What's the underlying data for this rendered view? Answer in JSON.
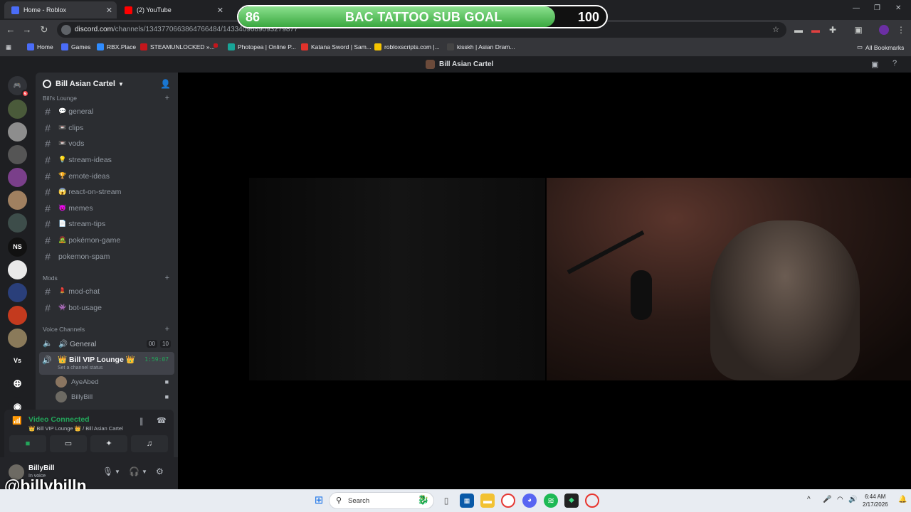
{
  "browser": {
    "tabs": [
      {
        "title": "Home - Roblox",
        "color": "#4a6cf7"
      },
      {
        "title": "(2) YouTube",
        "color": "#ff0000"
      }
    ],
    "url_main": "discord.com",
    "url_rest": "/channels/1343770663864766484/1433409689093279877",
    "bookmarks": [
      {
        "label": "Home",
        "color": "#4a6cf7"
      },
      {
        "label": "Games",
        "color": "#4a6cf7"
      },
      {
        "label": "RBX.Place",
        "color": "#2f8cff"
      },
      {
        "label": "STEAMUNLOCKED »...",
        "color": "#c4161c"
      },
      {
        "label": "Photopea | Online P...",
        "color": "#18a497"
      },
      {
        "label": "Katana Sword | Sam...",
        "color": "#e0322b"
      },
      {
        "label": "robloxscripts.com |...",
        "color": "#f5c400"
      },
      {
        "label": "kisskh | Asian Dram...",
        "color": "#444"
      }
    ],
    "all_bookmarks": "All Bookmarks"
  },
  "goal": {
    "current": "86",
    "label": "BAC TATTOO SUB GOAL",
    "target": "100",
    "progress_fraction": 0.86
  },
  "discord": {
    "window_title": "Bill Asian Cartel",
    "server_name": "Bill Asian Cartel",
    "home_badge": "5",
    "server_labels": [
      "NS",
      "Vs"
    ],
    "categories": {
      "lounge": "Bill's Lounge",
      "mods": "Mods",
      "voice": "Voice Channels"
    },
    "text_channels": [
      {
        "name": "general",
        "emoji": "💬"
      },
      {
        "name": "clips",
        "emoji": "📼"
      },
      {
        "name": "vods",
        "emoji": "📼"
      },
      {
        "name": "stream-ideas",
        "emoji": "💡"
      },
      {
        "name": "emote-ideas",
        "emoji": "🏆"
      },
      {
        "name": "react-on-stream",
        "emoji": "😱"
      },
      {
        "name": "memes",
        "emoji": "😈"
      },
      {
        "name": "stream-tips",
        "emoji": "📄"
      },
      {
        "name": "pokémon-game",
        "emoji": "🧟"
      },
      {
        "name": "pokemon-spam",
        "emoji": ""
      }
    ],
    "mod_channels": [
      {
        "name": "mod-chat",
        "emoji": "💄"
      },
      {
        "name": "bot-usage",
        "emoji": "👾"
      }
    ],
    "voice_general": {
      "name": "General",
      "emoji": "🔊",
      "count_a": "00",
      "count_b": "10"
    },
    "voice_active": {
      "name": "👑 Bill VIP Lounge 👑",
      "status": "Set a channel status",
      "timer": "1:59:07"
    },
    "members": [
      "AyeAbed",
      "BillyBill"
    ],
    "voice_panel": {
      "title": "Video Connected",
      "subtitle": "👑 Bill VIP Lounge 👑 / Bill Asian Cartel"
    },
    "user": {
      "name": "BillyBill",
      "status": "In voice"
    }
  },
  "watermark": "@billybilln",
  "taskbar": {
    "search_placeholder": "Search",
    "time": "6:44 AM",
    "date": "2/17/2026"
  }
}
